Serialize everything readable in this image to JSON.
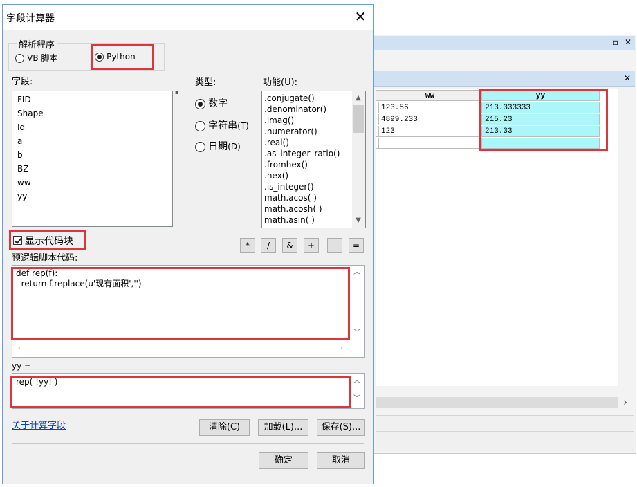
{
  "background_table": {
    "columns": [
      "ww",
      "yy"
    ],
    "rows": [
      [
        "123.56",
        "213.333333"
      ],
      [
        "4899.233",
        "215.23"
      ],
      [
        "123",
        "213.33"
      ],
      [
        "",
        ""
      ]
    ]
  },
  "dialog": {
    "title": "字段计算器",
    "parser": {
      "legend": "解析程序",
      "options": [
        "VB 脚本",
        "Python"
      ],
      "selected": "Python"
    },
    "fields": {
      "label": "字段:",
      "items": [
        "FID",
        "Shape",
        "Id",
        "a",
        "b",
        "BZ",
        "ww",
        "yy"
      ]
    },
    "type": {
      "label": "类型:",
      "options": [
        "数字",
        "字符串",
        "日期"
      ],
      "shortcuts": [
        "",
        "(T)",
        "(D)"
      ],
      "selected": "数字"
    },
    "functions": {
      "label": "功能(U):",
      "items": [
        ".conjugate()",
        ".denominator()",
        ".imag()",
        ".numerator()",
        ".real()",
        ".as_integer_ratio()",
        ".fromhex()",
        ".hex()",
        ".is_integer()",
        "math.acos( )",
        "math.acosh( )",
        "math.asin( )"
      ]
    },
    "show_codeblock": {
      "label": "显示代码块",
      "checked": true
    },
    "operators": [
      "*",
      "/",
      "&",
      "+",
      "-",
      "="
    ],
    "pre_logic": {
      "label": "预逻辑脚本代码:",
      "code_line1": "def rep(f):",
      "code_line2": "  return f.replace(u'现有面积','')"
    },
    "expression": {
      "label": "yy =",
      "code": "rep( !yy! )"
    },
    "about_link": "关于计算字段",
    "buttons": {
      "clear": "清除(C)",
      "load": "加载(L)...",
      "save": "保存(S)...",
      "ok": "确定",
      "cancel": "取消"
    }
  }
}
